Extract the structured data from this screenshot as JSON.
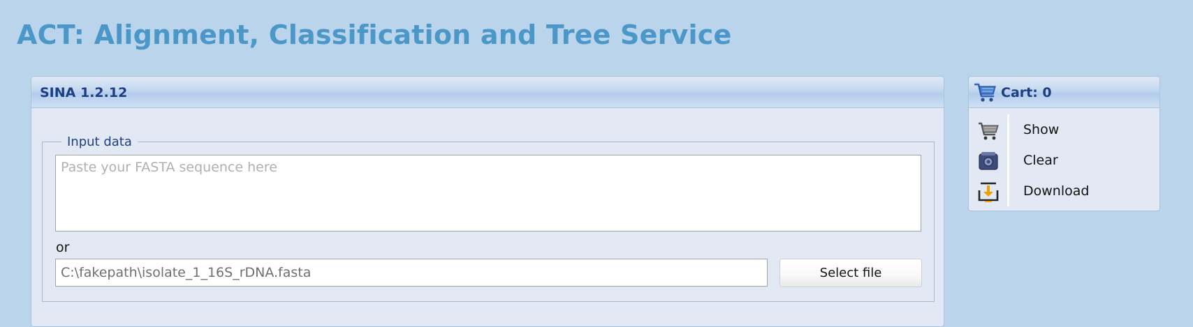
{
  "page": {
    "title": "ACT: Alignment, Classification and Tree Service"
  },
  "main_panel": {
    "title": "SINA 1.2.12",
    "input_fieldset": {
      "legend": "Input data",
      "sequence_placeholder": "Paste your FASTA sequence here",
      "or_label": "or",
      "file_path_value": "C:\\fakepath\\isolate_1_16S_rDNA.fasta",
      "select_file_label": "Select file"
    }
  },
  "cart": {
    "title": "Cart: 0",
    "header_icon": "shopping-cart-icon",
    "items": [
      {
        "label": "Show",
        "icon": "cart-view-icon"
      },
      {
        "label": "Clear",
        "icon": "cart-clear-icon"
      },
      {
        "label": "Download",
        "icon": "download-icon"
      }
    ]
  },
  "colors": {
    "background": "#bad5eb",
    "title": "#4b97c8",
    "panel": "#e2e9f4",
    "header_text": "#1c3e82",
    "download_accent": "#f0a000"
  }
}
